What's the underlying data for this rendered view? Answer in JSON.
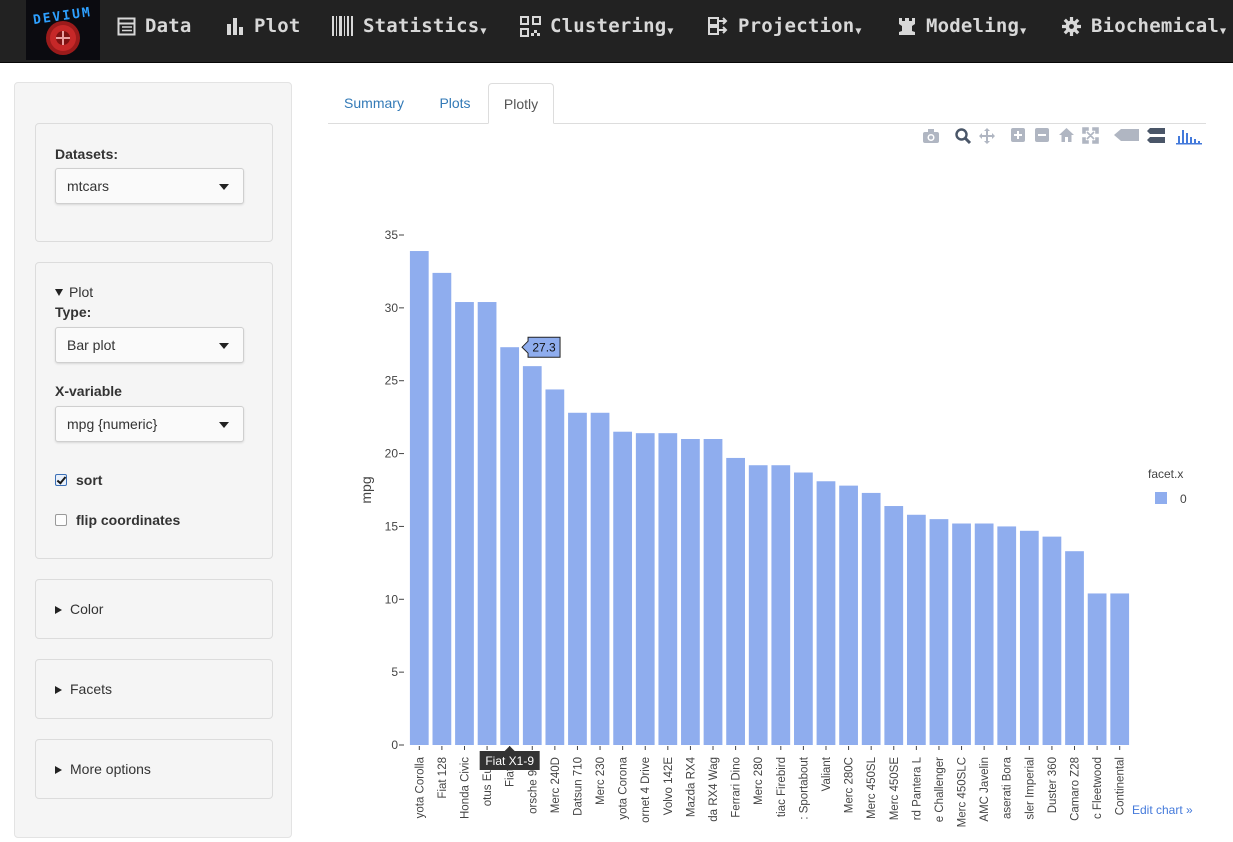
{
  "navbar": {
    "logo_text": "DEVIUM",
    "items": [
      {
        "label": "Data",
        "icon": "table-icon",
        "dropdown": false
      },
      {
        "label": "Plot",
        "icon": "bar-chart-icon",
        "dropdown": false
      },
      {
        "label": "Statistics",
        "icon": "barcode-icon",
        "dropdown": true
      },
      {
        "label": "Clustering",
        "icon": "qrcode-icon",
        "dropdown": true
      },
      {
        "label": "Projection",
        "icon": "random-icon",
        "dropdown": true
      },
      {
        "label": "Modeling",
        "icon": "rook-icon",
        "dropdown": true
      },
      {
        "label": "Biochemical",
        "icon": "gear-icon",
        "dropdown": true
      }
    ]
  },
  "sidebar": {
    "datasets_label": "Datasets:",
    "dataset_value": "mtcars",
    "plot_section_label": "Plot",
    "type_label": "Type:",
    "type_value": "Bar plot",
    "xvar_label": "X-variable",
    "xvar_value": "mpg {numeric}",
    "sort_label": "sort",
    "sort_checked": true,
    "flip_label": "flip coordinates",
    "flip_checked": false,
    "color_section_label": "Color",
    "facets_section_label": "Facets",
    "more_options_label": "More options"
  },
  "tabs": [
    {
      "label": "Summary",
      "active": false
    },
    {
      "label": "Plots",
      "active": false
    },
    {
      "label": "Plotly",
      "active": true
    }
  ],
  "modebar_icons": [
    "camera-icon",
    "zoom-icon",
    "pan-icon",
    "zoom-in-icon",
    "zoom-out-icon",
    "home-icon",
    "autoscale-icon",
    "hover-closest-icon",
    "hover-compare-icon",
    "plotly-logo-icon"
  ],
  "edit_chart_label": "Edit chart »",
  "colors": {
    "bar": "#8fadee",
    "navbar": "#222222",
    "link": "#337ab7"
  },
  "chart_data": {
    "type": "bar",
    "title": "",
    "xlabel": "",
    "ylabel": "mpg",
    "ylim": [
      0,
      35
    ],
    "yticks": [
      0,
      5,
      10,
      15,
      20,
      25,
      30,
      35
    ],
    "grid": false,
    "categories": [
      "yota Corolla",
      "Fiat 128",
      "Honda Civic",
      "otus Euro",
      "Fiat X",
      "orsche 914",
      "Merc 240D",
      "Datsun 710",
      "Merc 230",
      "yota Corona",
      "ornet 4 Drive",
      "Volvo 142E",
      "Mazda RX4",
      "da RX4 Wag",
      "Ferrari Dino",
      "Merc 280",
      "tiac Firebird",
      ": Sportabout",
      "Valiant",
      "Merc 280C",
      "Merc 450SL",
      "Merc 450SE",
      "rd Pantera L",
      "e Challenger",
      "Merc 450SLC",
      "AMC Javelin",
      "aserati Bora",
      "sler Imperial",
      "Duster 360",
      "Camaro Z28",
      "c Fleetwood",
      "Continental"
    ],
    "series": [
      {
        "name": "0",
        "values": [
          33.9,
          32.4,
          30.4,
          30.4,
          27.3,
          26.0,
          24.4,
          22.8,
          22.8,
          21.5,
          21.4,
          21.4,
          21.0,
          21.0,
          19.7,
          19.2,
          19.2,
          18.7,
          18.1,
          17.8,
          17.3,
          16.4,
          15.8,
          15.5,
          15.2,
          15.2,
          15.0,
          14.7,
          14.3,
          13.3,
          10.4,
          10.4
        ],
        "color": "#8fadee"
      }
    ],
    "legend": {
      "title": "facet.x",
      "position": "right"
    },
    "hover": {
      "index": 4,
      "value_label": "27.3",
      "category_label": "Fiat X1-9"
    }
  }
}
